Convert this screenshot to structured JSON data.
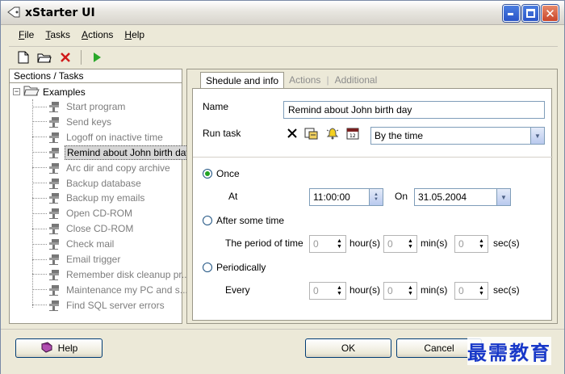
{
  "window": {
    "title": "xStarter UI"
  },
  "menu": {
    "file": "File",
    "tasks": "Tasks",
    "actions": "Actions",
    "help": "Help"
  },
  "toolbar": {
    "icons": [
      "new-document-icon",
      "open-folder-icon",
      "delete-x-icon",
      "run-play-icon"
    ]
  },
  "tree": {
    "header": "Sections / Tasks",
    "root": {
      "label": "Examples"
    },
    "items": [
      {
        "label": "Start program"
      },
      {
        "label": "Send keys"
      },
      {
        "label": "Logoff on inactive time"
      },
      {
        "label": "Remind about John birth day",
        "selected": true
      },
      {
        "label": "Arc dir and copy archive"
      },
      {
        "label": "Backup database"
      },
      {
        "label": "Backup my emails"
      },
      {
        "label": "Open CD-ROM"
      },
      {
        "label": "Close CD-ROM"
      },
      {
        "label": "Check mail"
      },
      {
        "label": "Email trigger"
      },
      {
        "label": "Remember disk cleanup pr..."
      },
      {
        "label": "Maintenance my PC and s..."
      },
      {
        "label": "Find SQL server errors"
      }
    ]
  },
  "tabs": [
    {
      "label": "Shedule and info",
      "active": true
    },
    {
      "label": "Actions"
    },
    {
      "label": "Additional"
    }
  ],
  "form": {
    "name_label": "Name",
    "name_value": "Remind about John birth day",
    "run_task_label": "Run task",
    "run_task_value": "By the time",
    "once_label": "Once",
    "at_label": "At",
    "at_value": "11:00:00",
    "on_label": "On",
    "on_value": "31.05.2004",
    "after_label": "After some time",
    "period_label": "The period of time",
    "periodically_label": "Periodically",
    "every_label": "Every",
    "zero": "0",
    "hours_unit": "hour(s)",
    "mins_unit": "min(s)",
    "secs_unit": "sec(s)"
  },
  "buttons": {
    "help": "Help",
    "ok": "OK",
    "cancel": "Cancel"
  },
  "watermark": "最需教育",
  "colors": {
    "selection": "#d7d7d7",
    "radio_on": "#22a322",
    "window_bg": "#ece9d8"
  }
}
